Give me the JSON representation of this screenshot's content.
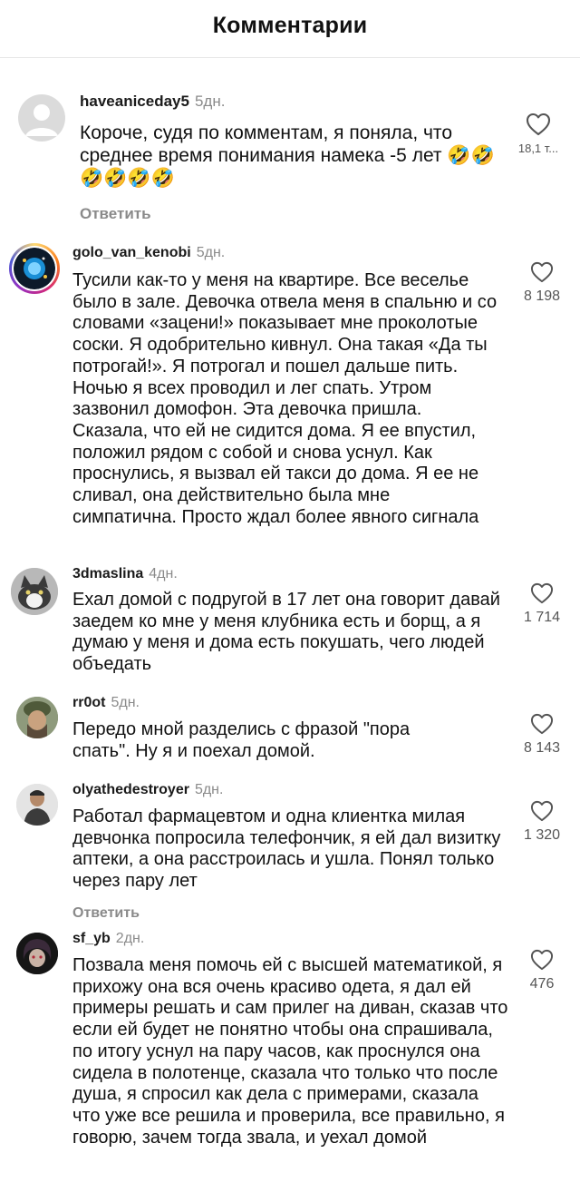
{
  "header": {
    "title": "Комментарии"
  },
  "comments": [
    {
      "user": "haveaniceday5",
      "time": "5дн.",
      "text": "Короче, судя по комментам, я поняла, что среднее время понимания намека -5 лет 🤣🤣🤣🤣🤣🤣",
      "likes": "18,1 т...",
      "reply": "Ответить",
      "avatar": "default-avatar"
    },
    {
      "user": "golo_van_kenobi",
      "time": "5дн.",
      "text": "Тусили как-то у меня на квартире. Все веселье было в зале. Девочка отвела меня в спальню и со словами «зацени!» показывает мне проколотые соски. Я одобрительно кивнул. Она такая «Да ты потрогай!». Я потрогал и пошел дальше пить. Ночью я всех проводил и  лег спать. Утром зазвонил домофон. Эта девочка пришла. Сказала, что ей не сидится дома. Я ее впустил, положил рядом с собой и снова уснул. Как проснулись, я вызвал ей такси до дома. Я ее не сливал, она действительно была мне симпатична. Просто ждал более явного сигнала",
      "likes": "8 198",
      "avatar": "story-ring-avatar"
    },
    {
      "user": "3dmaslina",
      "time": "4дн.",
      "text": "Ехал домой с подругой в 17 лет она говорит давай заедем ко мне у меня клубника есть и борщ, а я думаю у меня и дома есть покушать, чего людей объедать",
      "likes": "1 714",
      "avatar": "cat-avatar"
    },
    {
      "user": "rr0ot",
      "time": "5дн.",
      "text": "Передо мной разделись с фразой \"пора спать\". Ну я и поехал домой.",
      "likes": "8 143",
      "avatar": "soldier-avatar"
    },
    {
      "user": "olyathedestroyer",
      "time": "5дн.",
      "text": "Работал фармацевтом и одна клиентка милая девчонка попросила телефончик, я ей дал визитку аптеки, а она расстроилась и ушла. Понял только через пару лет",
      "likes": "1 320",
      "reply": "Ответить",
      "avatar": "man-avatar"
    },
    {
      "user": "sf_yb",
      "time": "2дн.",
      "text": "Позвала меня помочь ей с высшей математикой, я прихожу она вся очень красиво одета, я дал ей примеры решать и сам прилег на диван, сказав что если ей будет не понятно чтобы она спрашивала, по итогу уснул на пару часов, как проснулся она сидела в полотенце, сказала что только что после душа, я спросил как дела с примерами, сказала что уже все решила и проверила, все правильно, я говорю, зачем тогда звала, и уехал домой",
      "likes": "476",
      "avatar": "dark-avatar"
    }
  ],
  "colors": {
    "text": "#111111",
    "muted": "#8a8a8a",
    "story_ring": "#d6249f"
  }
}
